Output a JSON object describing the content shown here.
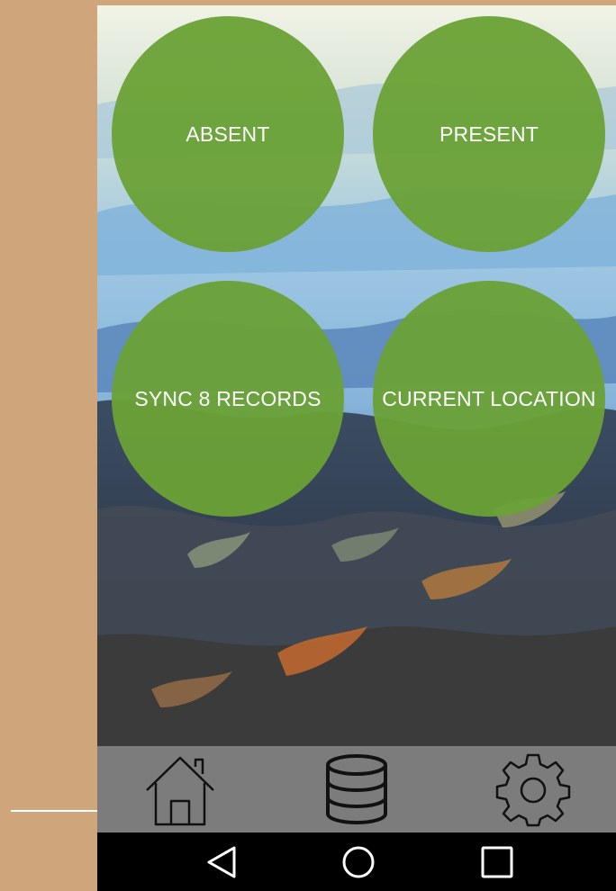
{
  "buttons": {
    "absent": "ABSENT",
    "present": "PRESENT",
    "sync": "SYNC 8 RECORDS",
    "location": "CURRENT LOCATION"
  },
  "bottom_nav": {
    "icons": [
      "home-icon",
      "database-icon",
      "gear-icon"
    ]
  },
  "system_nav": {
    "icons": [
      "back-icon",
      "home-circle-icon",
      "recents-icon"
    ]
  },
  "colors": {
    "button_green": "#6aa136",
    "bottom_bar": "#969696",
    "system_nav_bg": "#000000",
    "side_tan": "#cfa57b"
  }
}
